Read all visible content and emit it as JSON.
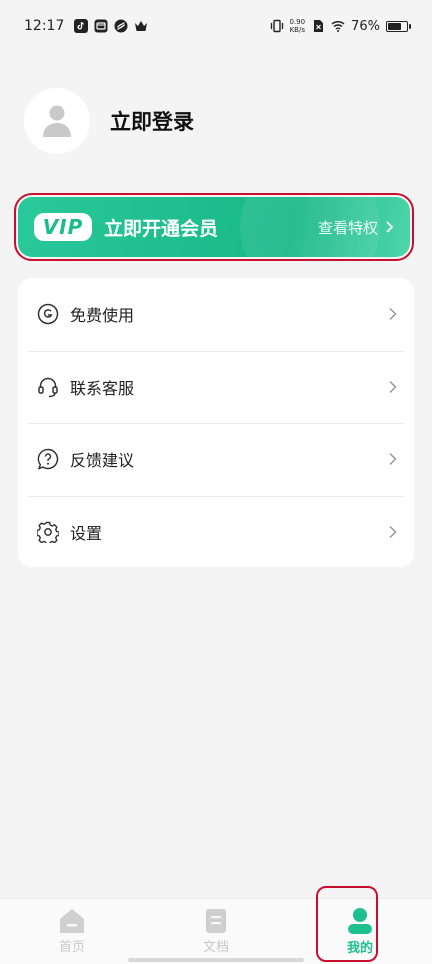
{
  "status_bar": {
    "time": "12:17",
    "net_speed_value": "0.90",
    "net_speed_unit": "KB/s",
    "battery_percent": "76%",
    "battery_level": 0.76
  },
  "profile": {
    "login_text": "立即登录"
  },
  "vip": {
    "badge": "VIP",
    "title": "立即开通会员",
    "link": "查看特权"
  },
  "menu": [
    {
      "label": "免费使用",
      "icon": "g-circle-icon"
    },
    {
      "label": "联系客服",
      "icon": "headset-icon"
    },
    {
      "label": "反馈建议",
      "icon": "question-bubble-icon"
    },
    {
      "label": "设置",
      "icon": "gear-icon"
    }
  ],
  "nav": [
    {
      "label": "首页",
      "icon": "home-icon",
      "active": false
    },
    {
      "label": "文档",
      "icon": "document-icon",
      "active": false
    },
    {
      "label": "我的",
      "icon": "user-icon",
      "active": true
    }
  ],
  "colors": {
    "accent": "#1fbf8f",
    "highlight": "#c8102e",
    "background": "#f4f4f4"
  }
}
